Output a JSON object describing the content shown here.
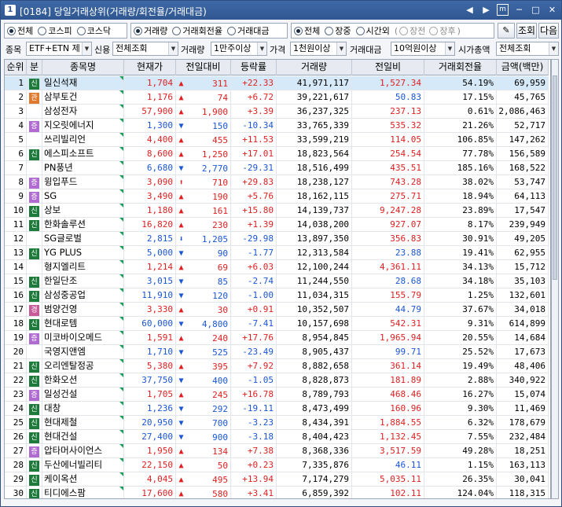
{
  "window": {
    "number": "1",
    "title": "[0184] 당일거래상위(거래량/회전율/거래대금)",
    "buttons": [
      "◀",
      "▶",
      "m",
      "─",
      "□",
      "✕"
    ]
  },
  "filters": {
    "market_options": [
      "전체",
      "코스피",
      "코스닥"
    ],
    "market_selected": 0,
    "sort_options": [
      "거래량",
      "거래회전율",
      "거래대금"
    ],
    "sort_selected": 0,
    "session_options": [
      "전체",
      "장중",
      "시간외"
    ],
    "session_selected": 0,
    "subsession_options": [
      "장전",
      "장후"
    ],
    "subsession_open": "(",
    "subsession_close": ")",
    "settings_icon": "✎",
    "query_button": "조회",
    "next_button": "다음"
  },
  "criteria": {
    "item_label": "종목",
    "item_value": "ETF+ETN 제",
    "credit_label": "신용",
    "credit_value": "전체조회",
    "volume_label": "거래량",
    "volume_value": "1만주이상",
    "price_label": "가격",
    "price_value": "1천원이상",
    "amount_label": "거래대금",
    "amount_value": "10억원이상",
    "mcap_label": "시가총액",
    "mcap_value": "전체조회"
  },
  "table": {
    "headers": [
      "순위",
      "분",
      "종목명",
      "현재가",
      "전일대비",
      "등락률",
      "거래량",
      "전일비",
      "거래회전율",
      "금액(백만)"
    ],
    "rows": [
      {
        "rank": "1",
        "badge": "신",
        "name": "일신석재",
        "price": "1,704",
        "dir": "up",
        "sym": "▲",
        "change": "311",
        "rate": "+22.33",
        "volume": "41,971,117",
        "prev": "1,527.34",
        "prev_dir": "up",
        "turnover": "54.19%",
        "amount": "69,959"
      },
      {
        "rank": "2",
        "badge": "관",
        "name": "삼부토건",
        "price": "1,176",
        "dir": "up",
        "sym": "▲",
        "change": "74",
        "rate": "+6.72",
        "volume": "39,221,617",
        "prev": "50.83",
        "prev_dir": "dn",
        "turnover": "17.15%",
        "amount": "45,765"
      },
      {
        "rank": "3",
        "badge": "",
        "name": "삼성전자",
        "price": "57,900",
        "dir": "up",
        "sym": "▲",
        "change": "1,900",
        "rate": "+3.39",
        "volume": "36,237,325",
        "prev": "237.13",
        "prev_dir": "up",
        "turnover": "0.61%",
        "amount": "2,086,463"
      },
      {
        "rank": "4",
        "badge": "증",
        "name": "지오릿에너지",
        "price": "1,300",
        "dir": "dn",
        "sym": "▼",
        "change": "150",
        "rate": "-10.34",
        "volume": "33,765,339",
        "prev": "535.32",
        "prev_dir": "up",
        "turnover": "21.26%",
        "amount": "52,717"
      },
      {
        "rank": "5",
        "badge": "",
        "name": "쓰리빌리언",
        "price": "4,400",
        "dir": "up",
        "sym": "▲",
        "change": "455",
        "rate": "+11.53",
        "volume": "33,599,219",
        "prev": "114.05",
        "prev_dir": "up",
        "turnover": "106.85%",
        "amount": "147,262"
      },
      {
        "rank": "6",
        "badge": "신",
        "name": "에스피소프트",
        "price": "8,600",
        "dir": "up",
        "sym": "▲",
        "change": "1,250",
        "rate": "+17.01",
        "volume": "18,823,564",
        "prev": "254.54",
        "prev_dir": "up",
        "turnover": "77.78%",
        "amount": "156,589"
      },
      {
        "rank": "7",
        "badge": "",
        "name": "PN풍년",
        "price": "6,680",
        "dir": "dn",
        "sym": "▼",
        "change": "2,770",
        "rate": "-29.31",
        "volume": "18,516,499",
        "prev": "435.51",
        "prev_dir": "up",
        "turnover": "185.16%",
        "amount": "168,522"
      },
      {
        "rank": "8",
        "badge": "증",
        "name": "윙입푸드",
        "price": "3,090",
        "dir": "up",
        "sym": "⬆",
        "change": "710",
        "rate": "+29.83",
        "volume": "18,238,127",
        "prev": "743.28",
        "prev_dir": "up",
        "turnover": "38.02%",
        "amount": "53,747"
      },
      {
        "rank": "9",
        "badge": "증",
        "name": "SG",
        "price": "3,490",
        "dir": "up",
        "sym": "▲",
        "change": "190",
        "rate": "+5.76",
        "volume": "18,162,115",
        "prev": "275.71",
        "prev_dir": "up",
        "turnover": "18.94%",
        "amount": "64,113"
      },
      {
        "rank": "10",
        "badge": "신",
        "name": "상보",
        "price": "1,180",
        "dir": "up",
        "sym": "▲",
        "change": "161",
        "rate": "+15.80",
        "volume": "14,139,737",
        "prev": "9,247.28",
        "prev_dir": "up",
        "turnover": "23.89%",
        "amount": "17,547"
      },
      {
        "rank": "11",
        "badge": "신",
        "name": "한화솔루션",
        "price": "16,820",
        "dir": "up",
        "sym": "▲",
        "change": "230",
        "rate": "+1.39",
        "volume": "14,038,200",
        "prev": "927.07",
        "prev_dir": "up",
        "turnover": "8.17%",
        "amount": "239,949"
      },
      {
        "rank": "12",
        "badge": "",
        "name": "SG글로벌",
        "price": "2,815",
        "dir": "dn",
        "sym": "⬇",
        "change": "1,205",
        "rate": "-29.98",
        "volume": "13,897,350",
        "prev": "356.83",
        "prev_dir": "up",
        "turnover": "30.91%",
        "amount": "49,205"
      },
      {
        "rank": "13",
        "badge": "신",
        "name": "YG PLUS",
        "price": "5,000",
        "dir": "dn",
        "sym": "▼",
        "change": "90",
        "rate": "-1.77",
        "volume": "12,313,584",
        "prev": "23.88",
        "prev_dir": "dn",
        "turnover": "19.41%",
        "amount": "62,955"
      },
      {
        "rank": "14",
        "badge": "",
        "name": "형지엘리트",
        "price": "1,214",
        "dir": "up",
        "sym": "▲",
        "change": "69",
        "rate": "+6.03",
        "volume": "12,100,244",
        "prev": "4,361.11",
        "prev_dir": "up",
        "turnover": "34.13%",
        "amount": "15,712"
      },
      {
        "rank": "15",
        "badge": "신",
        "name": "한일단조",
        "price": "3,015",
        "dir": "dn",
        "sym": "▼",
        "change": "85",
        "rate": "-2.74",
        "volume": "11,244,550",
        "prev": "28.68",
        "prev_dir": "dn",
        "turnover": "34.18%",
        "amount": "35,103"
      },
      {
        "rank": "16",
        "badge": "신",
        "name": "삼성중공업",
        "price": "11,910",
        "dir": "dn",
        "sym": "▼",
        "change": "120",
        "rate": "-1.00",
        "volume": "11,034,315",
        "prev": "155.79",
        "prev_dir": "up",
        "turnover": "1.25%",
        "amount": "132,601"
      },
      {
        "rank": "17",
        "badge": "경",
        "name": "범양건영",
        "price": "3,330",
        "dir": "up",
        "sym": "▲",
        "change": "30",
        "rate": "+0.91",
        "volume": "10,352,507",
        "prev": "44.79",
        "prev_dir": "dn",
        "turnover": "37.67%",
        "amount": "34,018"
      },
      {
        "rank": "18",
        "badge": "신",
        "name": "현대로템",
        "price": "60,000",
        "dir": "dn",
        "sym": "▼",
        "change": "4,800",
        "rate": "-7.41",
        "volume": "10,157,698",
        "prev": "542.31",
        "prev_dir": "up",
        "turnover": "9.31%",
        "amount": "614,899"
      },
      {
        "rank": "19",
        "badge": "증",
        "name": "미코바이오메드",
        "price": "1,591",
        "dir": "up",
        "sym": "▲",
        "change": "240",
        "rate": "+17.76",
        "volume": "8,954,845",
        "prev": "1,965.94",
        "prev_dir": "up",
        "turnover": "20.55%",
        "amount": "14,684"
      },
      {
        "rank": "20",
        "badge": "",
        "name": "국영지앤엠",
        "price": "1,710",
        "dir": "dn",
        "sym": "▼",
        "change": "525",
        "rate": "-23.49",
        "volume": "8,905,437",
        "prev": "99.71",
        "prev_dir": "dn",
        "turnover": "25.52%",
        "amount": "17,673"
      },
      {
        "rank": "21",
        "badge": "신",
        "name": "오리엔탈정공",
        "price": "5,380",
        "dir": "up",
        "sym": "▲",
        "change": "395",
        "rate": "+7.92",
        "volume": "8,882,658",
        "prev": "361.14",
        "prev_dir": "up",
        "turnover": "19.49%",
        "amount": "48,406"
      },
      {
        "rank": "22",
        "badge": "신",
        "name": "한화오션",
        "price": "37,750",
        "dir": "dn",
        "sym": "▼",
        "change": "400",
        "rate": "-1.05",
        "volume": "8,828,873",
        "prev": "181.89",
        "prev_dir": "up",
        "turnover": "2.88%",
        "amount": "340,922"
      },
      {
        "rank": "23",
        "badge": "증",
        "name": "일성건설",
        "price": "1,705",
        "dir": "up",
        "sym": "▲",
        "change": "245",
        "rate": "+16.78",
        "volume": "8,789,793",
        "prev": "468.46",
        "prev_dir": "up",
        "turnover": "16.27%",
        "amount": "15,074"
      },
      {
        "rank": "24",
        "badge": "신",
        "name": "대창",
        "price": "1,236",
        "dir": "dn",
        "sym": "▼",
        "change": "292",
        "rate": "-19.11",
        "volume": "8,473,499",
        "prev": "160.96",
        "prev_dir": "up",
        "turnover": "9.30%",
        "amount": "11,469"
      },
      {
        "rank": "25",
        "badge": "신",
        "name": "현대제철",
        "price": "20,950",
        "dir": "dn",
        "sym": "▼",
        "change": "700",
        "rate": "-3.23",
        "volume": "8,434,391",
        "prev": "1,884.55",
        "prev_dir": "up",
        "turnover": "6.32%",
        "amount": "178,679"
      },
      {
        "rank": "26",
        "badge": "신",
        "name": "현대건설",
        "price": "27,400",
        "dir": "dn",
        "sym": "▼",
        "change": "900",
        "rate": "-3.18",
        "volume": "8,404,423",
        "prev": "1,132.45",
        "prev_dir": "up",
        "turnover": "7.55%",
        "amount": "232,484"
      },
      {
        "rank": "27",
        "badge": "증",
        "name": "압타머사이언스",
        "price": "1,950",
        "dir": "up",
        "sym": "▲",
        "change": "134",
        "rate": "+7.38",
        "volume": "8,368,336",
        "prev": "3,517.59",
        "prev_dir": "up",
        "turnover": "49.28%",
        "amount": "18,251"
      },
      {
        "rank": "28",
        "badge": "신",
        "name": "두산에너빌리티",
        "price": "22,150",
        "dir": "up",
        "sym": "▲",
        "change": "50",
        "rate": "+0.23",
        "volume": "7,335,876",
        "prev": "46.11",
        "prev_dir": "dn",
        "turnover": "1.15%",
        "amount": "163,113"
      },
      {
        "rank": "29",
        "badge": "신",
        "name": "케이옥션",
        "price": "4,045",
        "dir": "up",
        "sym": "▲",
        "change": "495",
        "rate": "+13.94",
        "volume": "7,174,279",
        "prev": "5,035.11",
        "prev_dir": "up",
        "turnover": "26.35%",
        "amount": "30,041"
      },
      {
        "rank": "30",
        "badge": "신",
        "name": "티디에스팜",
        "price": "17,600",
        "dir": "up",
        "sym": "▲",
        "change": "580",
        "rate": "+3.41",
        "volume": "6,859,392",
        "prev": "102.11",
        "prev_dir": "up",
        "turnover": "124.04%",
        "amount": "118,315"
      }
    ]
  },
  "colors": {
    "up": "#e02020",
    "down": "#1a56d8",
    "selected_row": "#d6e9f8",
    "title_bar": "#2f568f"
  }
}
